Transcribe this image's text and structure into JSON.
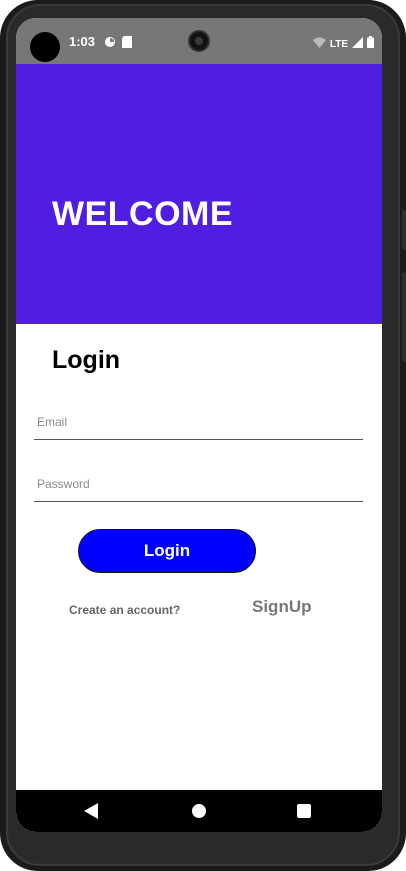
{
  "status_bar": {
    "time": "1:03",
    "network": "LTE",
    "icons": [
      "notification-icon",
      "sd-card-icon",
      "wifi-icon",
      "signal-icon",
      "battery-icon"
    ]
  },
  "hero": {
    "title": "WELCOME",
    "background_color": "#4f1ee0"
  },
  "login_form": {
    "title": "Login",
    "email": {
      "value": "",
      "placeholder": "Email"
    },
    "password": {
      "value": "",
      "placeholder": "Password"
    },
    "submit_label": "Login",
    "submit_color": "#0000ff",
    "create_account_text": "Create an account?",
    "signup_label": "SignUp"
  },
  "navigation": {
    "icons": [
      "back-icon",
      "home-icon",
      "recents-icon"
    ]
  }
}
